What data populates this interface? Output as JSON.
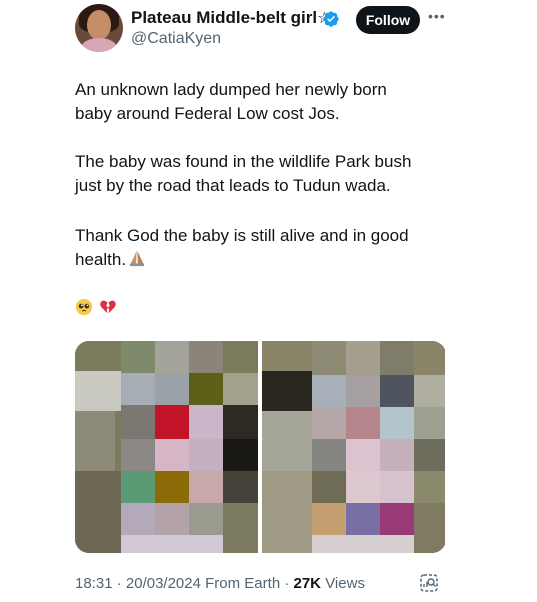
{
  "author": {
    "display_name": "Plateau Middle-belt girl",
    "name_symbol": "☆",
    "handle": "@CatiaKyen",
    "verified": true
  },
  "actions": {
    "follow_label": "Follow",
    "more_icon": "more-horizontal-icon"
  },
  "tweet": {
    "paragraphs": [
      "An unknown lady dumped her newly born\nbaby around Federal Low cost Jos.",
      "The baby was  found in the wildlife Park bush\njust by the road that leads to Tudun wada.",
      "Thank God the baby is still alive and in good\nhealth."
    ],
    "emoji_icons": [
      "pleading-face-icon",
      "broken-heart-icon"
    ]
  },
  "media": {
    "photo_count": 2,
    "description": "pixelated photos"
  },
  "footer": {
    "time": "18:31",
    "date": "20/03/2024",
    "source": "From Earth",
    "views_count": "27K",
    "views_label": "Views",
    "analytics_icon": "analytics-icon"
  },
  "colors": {
    "text": "#0f1419",
    "secondary": "#536471",
    "verified": "#1d9bf0",
    "follow_bg": "#0f1419"
  }
}
